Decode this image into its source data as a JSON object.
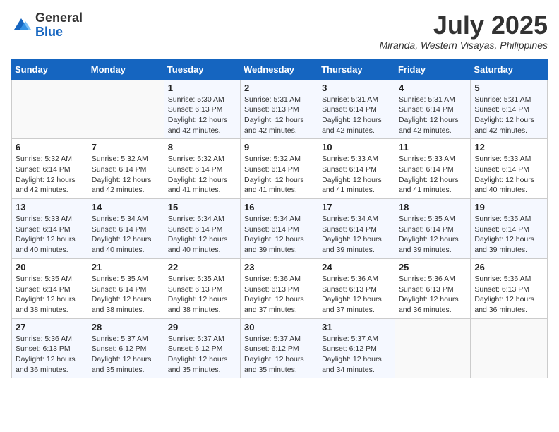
{
  "header": {
    "logo_general": "General",
    "logo_blue": "Blue",
    "month_title": "July 2025",
    "location": "Miranda, Western Visayas, Philippines"
  },
  "days_of_week": [
    "Sunday",
    "Monday",
    "Tuesday",
    "Wednesday",
    "Thursday",
    "Friday",
    "Saturday"
  ],
  "weeks": [
    [
      {
        "day": "",
        "sunrise": "",
        "sunset": "",
        "daylight": ""
      },
      {
        "day": "",
        "sunrise": "",
        "sunset": "",
        "daylight": ""
      },
      {
        "day": "1",
        "sunrise": "Sunrise: 5:30 AM",
        "sunset": "Sunset: 6:13 PM",
        "daylight": "Daylight: 12 hours and 42 minutes."
      },
      {
        "day": "2",
        "sunrise": "Sunrise: 5:31 AM",
        "sunset": "Sunset: 6:13 PM",
        "daylight": "Daylight: 12 hours and 42 minutes."
      },
      {
        "day": "3",
        "sunrise": "Sunrise: 5:31 AM",
        "sunset": "Sunset: 6:14 PM",
        "daylight": "Daylight: 12 hours and 42 minutes."
      },
      {
        "day": "4",
        "sunrise": "Sunrise: 5:31 AM",
        "sunset": "Sunset: 6:14 PM",
        "daylight": "Daylight: 12 hours and 42 minutes."
      },
      {
        "day": "5",
        "sunrise": "Sunrise: 5:31 AM",
        "sunset": "Sunset: 6:14 PM",
        "daylight": "Daylight: 12 hours and 42 minutes."
      }
    ],
    [
      {
        "day": "6",
        "sunrise": "Sunrise: 5:32 AM",
        "sunset": "Sunset: 6:14 PM",
        "daylight": "Daylight: 12 hours and 42 minutes."
      },
      {
        "day": "7",
        "sunrise": "Sunrise: 5:32 AM",
        "sunset": "Sunset: 6:14 PM",
        "daylight": "Daylight: 12 hours and 42 minutes."
      },
      {
        "day": "8",
        "sunrise": "Sunrise: 5:32 AM",
        "sunset": "Sunset: 6:14 PM",
        "daylight": "Daylight: 12 hours and 41 minutes."
      },
      {
        "day": "9",
        "sunrise": "Sunrise: 5:32 AM",
        "sunset": "Sunset: 6:14 PM",
        "daylight": "Daylight: 12 hours and 41 minutes."
      },
      {
        "day": "10",
        "sunrise": "Sunrise: 5:33 AM",
        "sunset": "Sunset: 6:14 PM",
        "daylight": "Daylight: 12 hours and 41 minutes."
      },
      {
        "day": "11",
        "sunrise": "Sunrise: 5:33 AM",
        "sunset": "Sunset: 6:14 PM",
        "daylight": "Daylight: 12 hours and 41 minutes."
      },
      {
        "day": "12",
        "sunrise": "Sunrise: 5:33 AM",
        "sunset": "Sunset: 6:14 PM",
        "daylight": "Daylight: 12 hours and 40 minutes."
      }
    ],
    [
      {
        "day": "13",
        "sunrise": "Sunrise: 5:33 AM",
        "sunset": "Sunset: 6:14 PM",
        "daylight": "Daylight: 12 hours and 40 minutes."
      },
      {
        "day": "14",
        "sunrise": "Sunrise: 5:34 AM",
        "sunset": "Sunset: 6:14 PM",
        "daylight": "Daylight: 12 hours and 40 minutes."
      },
      {
        "day": "15",
        "sunrise": "Sunrise: 5:34 AM",
        "sunset": "Sunset: 6:14 PM",
        "daylight": "Daylight: 12 hours and 40 minutes."
      },
      {
        "day": "16",
        "sunrise": "Sunrise: 5:34 AM",
        "sunset": "Sunset: 6:14 PM",
        "daylight": "Daylight: 12 hours and 39 minutes."
      },
      {
        "day": "17",
        "sunrise": "Sunrise: 5:34 AM",
        "sunset": "Sunset: 6:14 PM",
        "daylight": "Daylight: 12 hours and 39 minutes."
      },
      {
        "day": "18",
        "sunrise": "Sunrise: 5:35 AM",
        "sunset": "Sunset: 6:14 PM",
        "daylight": "Daylight: 12 hours and 39 minutes."
      },
      {
        "day": "19",
        "sunrise": "Sunrise: 5:35 AM",
        "sunset": "Sunset: 6:14 PM",
        "daylight": "Daylight: 12 hours and 39 minutes."
      }
    ],
    [
      {
        "day": "20",
        "sunrise": "Sunrise: 5:35 AM",
        "sunset": "Sunset: 6:14 PM",
        "daylight": "Daylight: 12 hours and 38 minutes."
      },
      {
        "day": "21",
        "sunrise": "Sunrise: 5:35 AM",
        "sunset": "Sunset: 6:14 PM",
        "daylight": "Daylight: 12 hours and 38 minutes."
      },
      {
        "day": "22",
        "sunrise": "Sunrise: 5:35 AM",
        "sunset": "Sunset: 6:13 PM",
        "daylight": "Daylight: 12 hours and 38 minutes."
      },
      {
        "day": "23",
        "sunrise": "Sunrise: 5:36 AM",
        "sunset": "Sunset: 6:13 PM",
        "daylight": "Daylight: 12 hours and 37 minutes."
      },
      {
        "day": "24",
        "sunrise": "Sunrise: 5:36 AM",
        "sunset": "Sunset: 6:13 PM",
        "daylight": "Daylight: 12 hours and 37 minutes."
      },
      {
        "day": "25",
        "sunrise": "Sunrise: 5:36 AM",
        "sunset": "Sunset: 6:13 PM",
        "daylight": "Daylight: 12 hours and 36 minutes."
      },
      {
        "day": "26",
        "sunrise": "Sunrise: 5:36 AM",
        "sunset": "Sunset: 6:13 PM",
        "daylight": "Daylight: 12 hours and 36 minutes."
      }
    ],
    [
      {
        "day": "27",
        "sunrise": "Sunrise: 5:36 AM",
        "sunset": "Sunset: 6:13 PM",
        "daylight": "Daylight: 12 hours and 36 minutes."
      },
      {
        "day": "28",
        "sunrise": "Sunrise: 5:37 AM",
        "sunset": "Sunset: 6:12 PM",
        "daylight": "Daylight: 12 hours and 35 minutes."
      },
      {
        "day": "29",
        "sunrise": "Sunrise: 5:37 AM",
        "sunset": "Sunset: 6:12 PM",
        "daylight": "Daylight: 12 hours and 35 minutes."
      },
      {
        "day": "30",
        "sunrise": "Sunrise: 5:37 AM",
        "sunset": "Sunset: 6:12 PM",
        "daylight": "Daylight: 12 hours and 35 minutes."
      },
      {
        "day": "31",
        "sunrise": "Sunrise: 5:37 AM",
        "sunset": "Sunset: 6:12 PM",
        "daylight": "Daylight: 12 hours and 34 minutes."
      },
      {
        "day": "",
        "sunrise": "",
        "sunset": "",
        "daylight": ""
      },
      {
        "day": "",
        "sunrise": "",
        "sunset": "",
        "daylight": ""
      }
    ]
  ]
}
